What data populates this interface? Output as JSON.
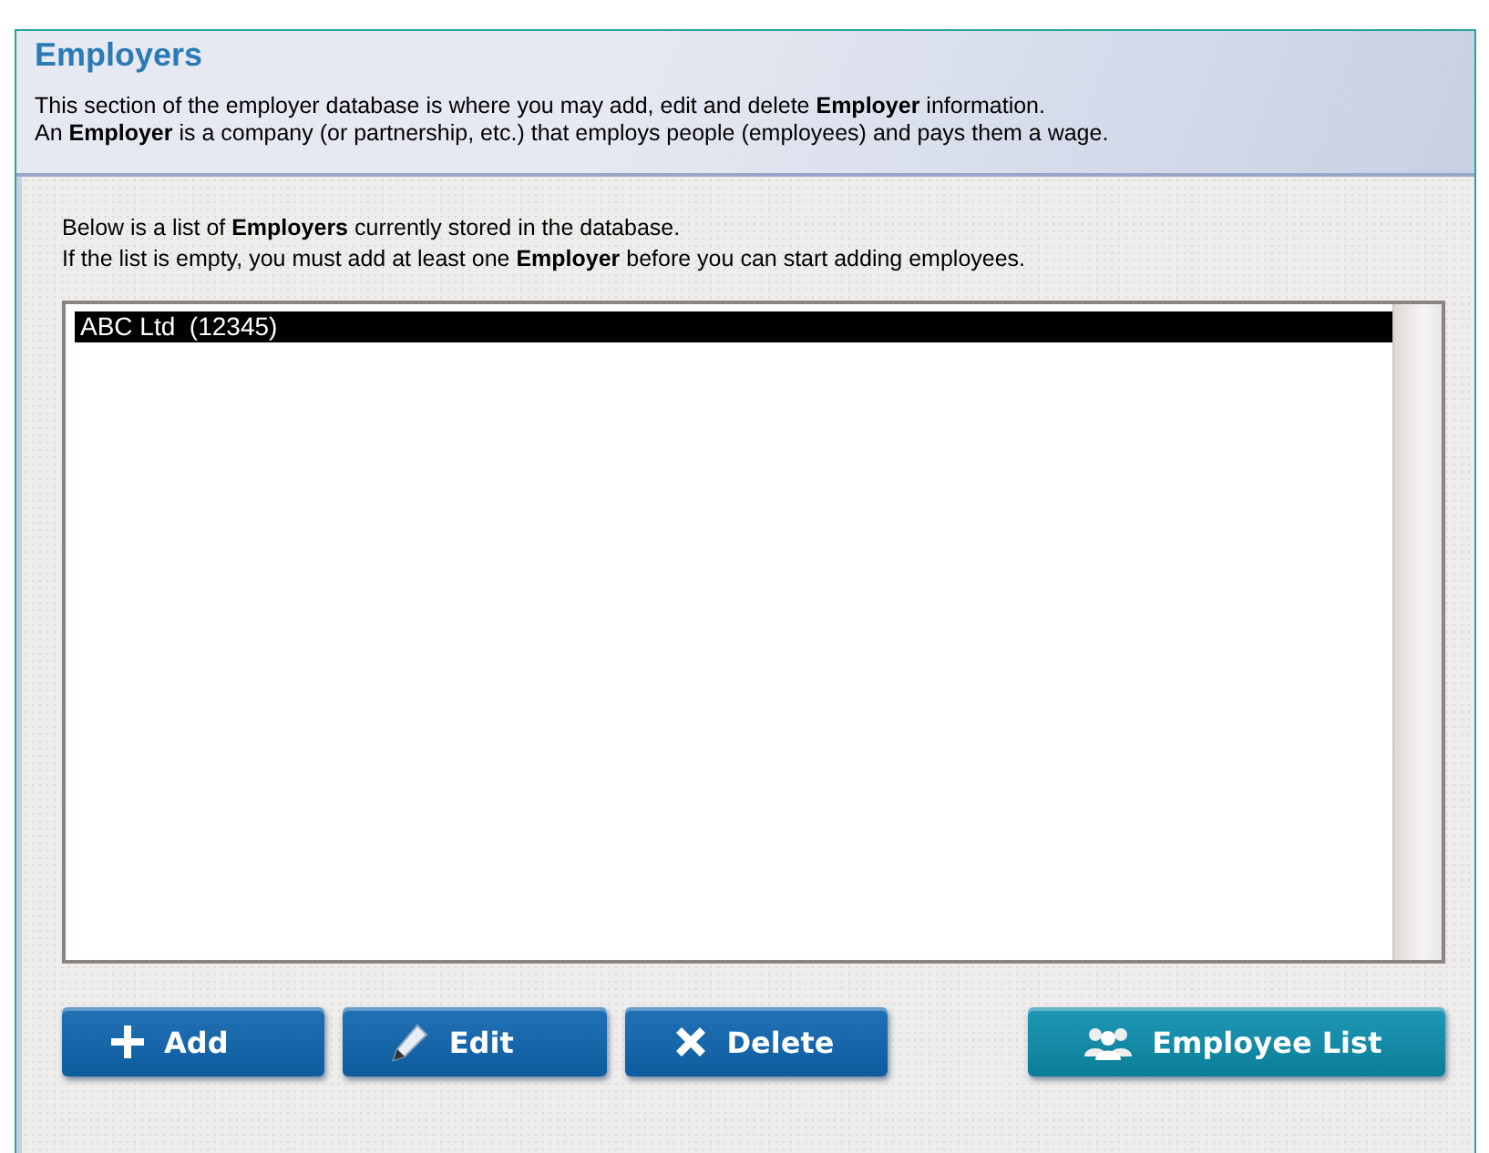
{
  "header": {
    "title": "Employers",
    "paragraphs": [
      "This section of the employer database is where you may add, edit and delete **Employer** information.",
      "An **Employer** is a company (or partnership, etc.) that employs people (employees) and pays them a wage."
    ]
  },
  "intro": [
    "Below is a list of **Employers** currently stored in the database.",
    "If the list is empty, you must add at least one **Employer** before you can start adding employees."
  ],
  "list": [
    {
      "label": "ABC Ltd  (12345)",
      "selected": true
    }
  ],
  "buttons": [
    {
      "label": "Add",
      "kind": "add"
    },
    {
      "label": "Edit",
      "kind": "edit"
    },
    {
      "label": "Delete",
      "kind": "delete"
    },
    {
      "label": "Employee List",
      "kind": "people"
    }
  ]
}
